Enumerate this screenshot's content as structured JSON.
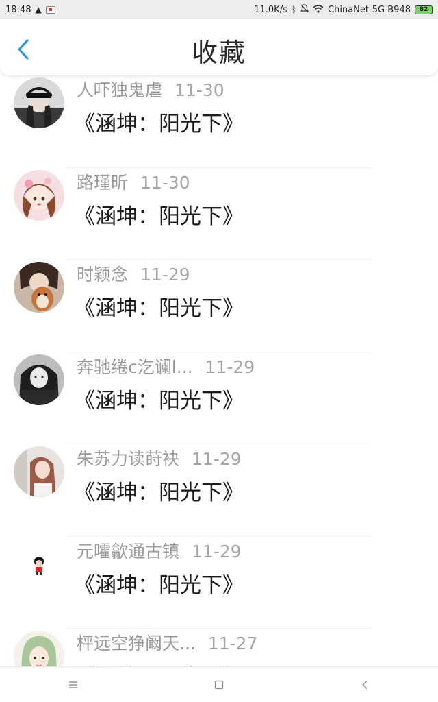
{
  "status_bar": {
    "time": "18:48",
    "net_speed": "11.0K/s",
    "network_name": "ChinaNet-5G-B948",
    "battery": "82",
    "icons": [
      "warning-icon",
      "app-notification-icon",
      "bluetooth-icon",
      "mute-icon",
      "wifi-icon",
      "battery-icon"
    ]
  },
  "header": {
    "title": "收藏",
    "back_icon": "chevron-left-icon",
    "accent": "#2f9ae0"
  },
  "favorites": [
    {
      "user": "人吓独鬼虐",
      "date": "11-30",
      "title": "《涵坤：阳光下》",
      "avatar": "photo-girl-black-cap"
    },
    {
      "user": "路瑾昕",
      "date": "11-30",
      "title": "《涵坤：阳光下》",
      "avatar": "illustrated-girl-pink-flowers"
    },
    {
      "user": "时颖念",
      "date": "11-29",
      "title": "《涵坤：阳光下》",
      "avatar": "photo-with-plush-toy"
    },
    {
      "user": "奔驰绻c汔谰l...",
      "date": "11-29",
      "title": "《涵坤：阳光下》",
      "avatar": "monochrome-girl-photo"
    },
    {
      "user": "朱苏力读莳袂",
      "date": "11-29",
      "title": "《涵坤：阳光下》",
      "avatar": "photo-girl-long-hair"
    },
    {
      "user": "元嚯歙通古镇",
      "date": "11-29",
      "title": "《涵坤：阳光下》",
      "avatar": "small-cartoon-figure"
    },
    {
      "user": "枰远空狰阚天...",
      "date": "11-27",
      "title": "《涵坤：阳光下》",
      "avatar": "illustrated-girl-green-hair"
    }
  ],
  "nav_bar": {
    "icons": [
      "menu-icon",
      "home-square-icon",
      "back-triangle-icon"
    ]
  },
  "colors": {
    "status_bg": "#ededed",
    "meta_text": "#9a9a9a",
    "title_text": "#1c1c1c",
    "battery_green": "#7ad35c"
  }
}
